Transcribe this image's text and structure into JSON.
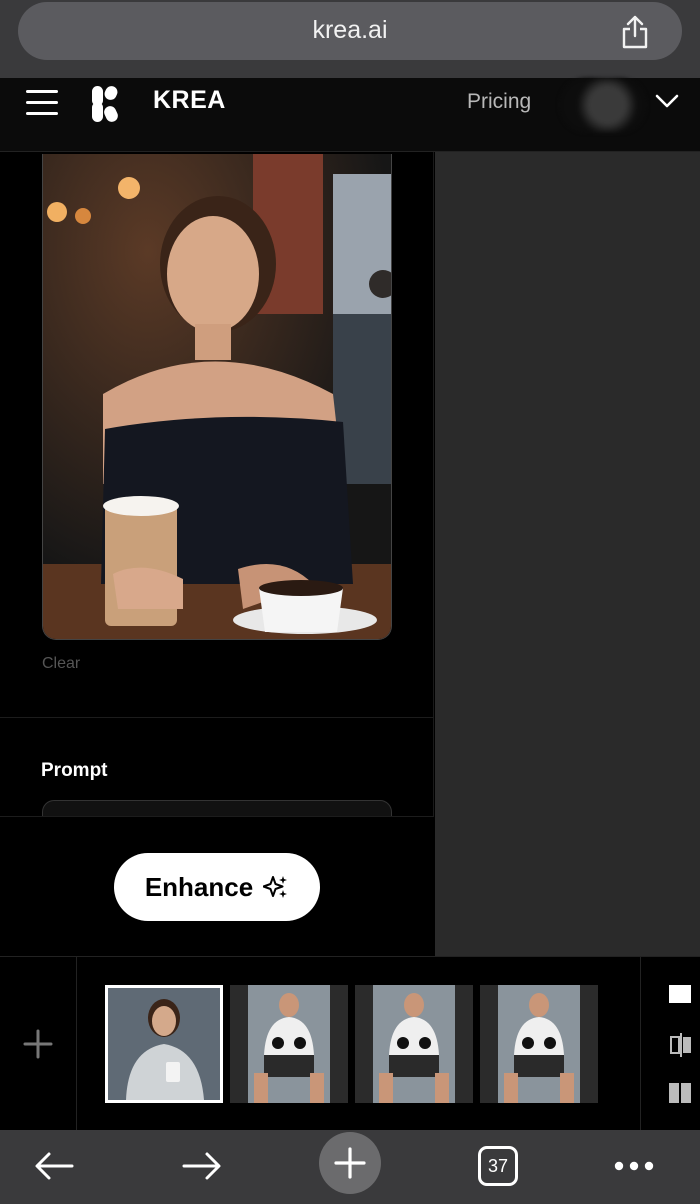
{
  "browser": {
    "url": "krea.ai",
    "open_tabs": "37"
  },
  "header": {
    "brand": "KREA",
    "pricing_link": "Pricing"
  },
  "editor": {
    "clear_label": "Clear",
    "prompt_label": "Prompt",
    "enhance_label": "Enhance"
  },
  "thumbnails": [
    {
      "subject": "woman holding coffee cup",
      "selected": true
    },
    {
      "subject": "man seated at gym",
      "selected": false
    },
    {
      "subject": "man seated at gym",
      "selected": false
    },
    {
      "subject": "man seated at gym",
      "selected": false
    }
  ],
  "icons": {
    "share": "share-icon",
    "menu": "hamburger-menu-icon",
    "logo": "krea-logo-icon",
    "account": "chevron-down-icon",
    "add_image": "plus-icon",
    "layout_single": "single-view-icon",
    "layout_compare": "compare-view-icon",
    "layout_split": "split-view-icon",
    "back": "arrow-left-icon",
    "forward": "arrow-right-icon",
    "new_tab": "plus-icon",
    "more": "more-icon"
  }
}
